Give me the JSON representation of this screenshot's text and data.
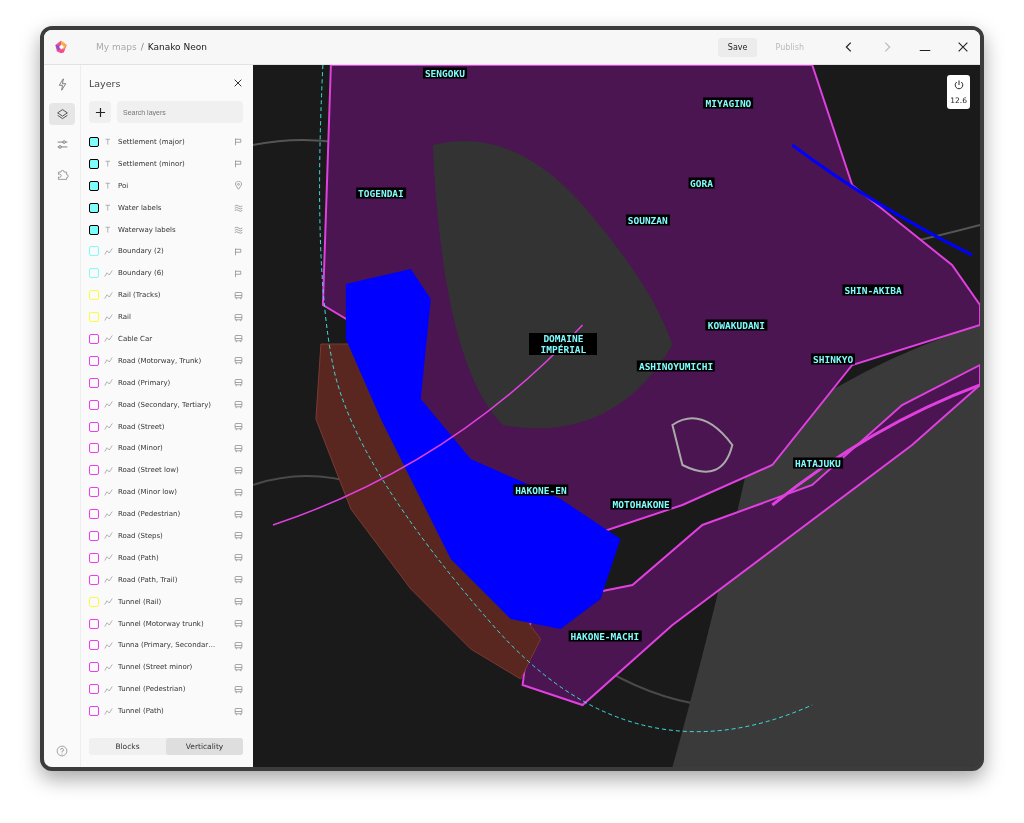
{
  "titlebar": {
    "crumbs": [
      "My maps",
      "Kanako Neon"
    ],
    "separator": "/",
    "buttons": [
      {
        "label": "Save",
        "disabled": false
      },
      {
        "label": "Publish",
        "disabled": true
      }
    ]
  },
  "rail": [
    {
      "selected": false
    },
    {
      "selected": true
    },
    {
      "selected": false
    },
    {
      "selected": false
    }
  ],
  "panel": {
    "title": "Layers",
    "search": {
      "placeholder": "Search layers"
    },
    "layers": [
      {
        "name": "Settlement (major)",
        "kind": "label",
        "color": "#7ffcfc"
      },
      {
        "name": "Settlement (minor)",
        "kind": "label",
        "color": "#7ffcfc"
      },
      {
        "name": "Poi",
        "kind": "label",
        "color": "#7ffcfc"
      },
      {
        "name": "Water labels",
        "kind": "label",
        "color": "#7ffcfc"
      },
      {
        "name": "Waterway labels",
        "kind": "label",
        "color": "#7ffcfc"
      },
      {
        "name": "Boundary (2)",
        "kind": "line",
        "color": "#7ffcfc"
      },
      {
        "name": "Boundary (6)",
        "kind": "line",
        "color": "#7ffcfc"
      },
      {
        "name": "Rail (Tracks)",
        "kind": "line",
        "color": "#fcfc3c"
      },
      {
        "name": "Rail",
        "kind": "line",
        "color": "#fcfc3c"
      },
      {
        "name": "Cable Car",
        "kind": "line",
        "color": "#f03cf0"
      },
      {
        "name": "Road (Motorway, Trunk)",
        "kind": "line",
        "color": "#f03cf0"
      },
      {
        "name": "Road (Primary)",
        "kind": "line",
        "color": "#f03cf0"
      },
      {
        "name": "Road (Secondary, Tertiary)",
        "kind": "line",
        "color": "#f03cf0"
      },
      {
        "name": "Road (Street)",
        "kind": "line",
        "color": "#f03cf0"
      },
      {
        "name": "Road (Minor)",
        "kind": "line",
        "color": "#f03cf0"
      },
      {
        "name": "Road (Street low)",
        "kind": "line",
        "color": "#f03cf0"
      },
      {
        "name": "Road (Minor low)",
        "kind": "line",
        "color": "#f03cf0"
      },
      {
        "name": "Road (Pedestrian)",
        "kind": "line",
        "color": "#f03cf0"
      },
      {
        "name": "Road (Steps)",
        "kind": "line",
        "color": "#f03cf0"
      },
      {
        "name": "Road (Path)",
        "kind": "line",
        "color": "#f03cf0"
      },
      {
        "name": "Road (Path, Trail)",
        "kind": "line",
        "color": "#f03cf0"
      },
      {
        "name": "Tunnel (Rail)",
        "kind": "line",
        "color": "#fcfc3c"
      },
      {
        "name": "Tunnel (Motorway trunk)",
        "kind": "line",
        "color": "#f03cf0"
      },
      {
        "name": "Tunna (Primary, Secondar…",
        "kind": "line",
        "color": "#f03cf0"
      },
      {
        "name": "Tunnel (Street minor)",
        "kind": "line",
        "color": "#f03cf0"
      },
      {
        "name": "Tunnel (Pedestrian)",
        "kind": "line",
        "color": "#f03cf0"
      },
      {
        "name": "Tunnel (Path)",
        "kind": "line",
        "color": "#f03cf0"
      }
    ],
    "tabs": [
      {
        "label": "Blocks",
        "selected": false
      },
      {
        "label": "Verticality",
        "selected": true
      }
    ]
  },
  "map": {
    "zoom": "12.6",
    "labels": [
      "SENGOKU",
      "MIYAGINO",
      "TOGENDAI",
      "GORA",
      "SOUNZAN",
      "SHIN-AKIBA",
      "DOMAINE IMPÉRIAL",
      "KOWAKUDANI",
      "ASHINOYUMICHI",
      "SHINKYO",
      "HATAJUKU",
      "HAKONE-EN",
      "MOTOHAKONE",
      "HAKONE-MACHI"
    ]
  }
}
